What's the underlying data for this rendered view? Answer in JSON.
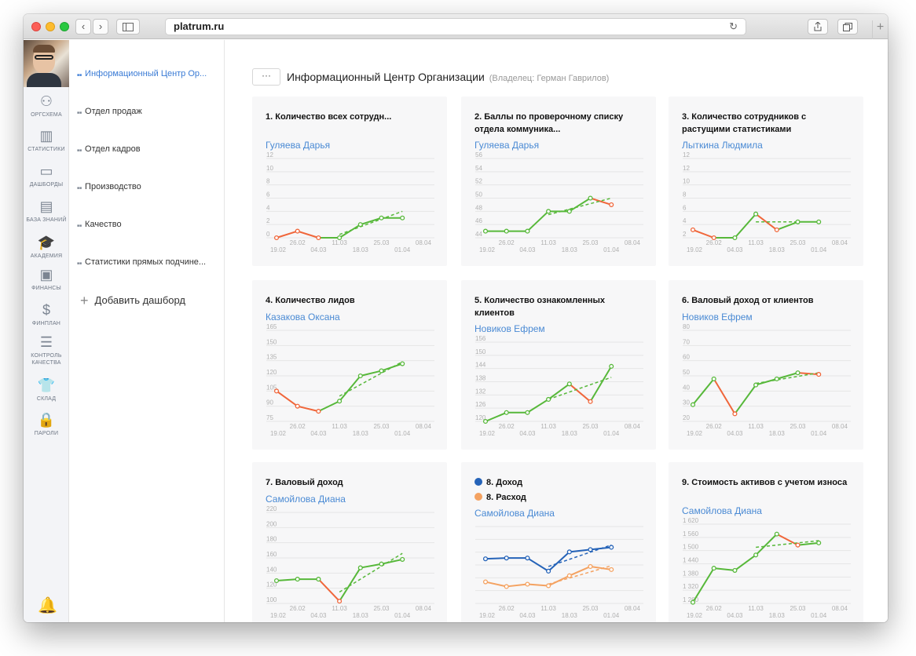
{
  "browser": {
    "url": "platrum.ru",
    "reload_icon": "↻",
    "new_tab_icon": "+"
  },
  "iconbar": {
    "items": [
      {
        "label": "ОРГСХЕМА",
        "icon": "org-chart-icon",
        "glyph": "⚇"
      },
      {
        "label": "СТАТИСТИКИ",
        "icon": "statistics-icon",
        "glyph": "▥"
      },
      {
        "label": "ДАШБОРДЫ",
        "icon": "dashboard-icon",
        "glyph": "▭"
      },
      {
        "label": "БАЗА ЗНАНИЙ",
        "icon": "knowledge-base-icon",
        "glyph": "▤"
      },
      {
        "label": "АКАДЕМИЯ",
        "icon": "academy-icon",
        "glyph": "🎓"
      },
      {
        "label": "ФИНАНСЫ",
        "icon": "finance-icon",
        "glyph": "▣"
      },
      {
        "label": "ФИНПЛАН",
        "icon": "finplan-icon",
        "glyph": "$"
      },
      {
        "label": "КОНТРОЛЬ КАЧЕСТВА",
        "icon": "quality-control-icon",
        "glyph": "☰"
      },
      {
        "label": "СКЛАД",
        "icon": "warehouse-icon",
        "glyph": "👕"
      },
      {
        "label": "ПАРОЛИ",
        "icon": "passwords-icon",
        "glyph": "🔒"
      }
    ],
    "bell_icon": "🔔"
  },
  "sidebar": {
    "items": [
      {
        "label": "Информационный Центр Ор...",
        "active": true
      },
      {
        "label": "Отдел продаж",
        "active": false
      },
      {
        "label": "Отдел кадров",
        "active": false
      },
      {
        "label": "Производство",
        "active": false
      },
      {
        "label": "Качество",
        "active": false
      },
      {
        "label": "Статистики прямых подчине...",
        "active": false
      }
    ],
    "add_label": "Добавить дашборд"
  },
  "header": {
    "more_label": "···",
    "title": "Информационный Центр Организации",
    "owner": "(Владелец: Герман Гаврилов)"
  },
  "colors": {
    "green": "#57b83a",
    "orange": "#f0663a",
    "blue": "#2563b8",
    "light_orange": "#f4a261",
    "grid": "#e6e6e6",
    "axis_text": "#b0b0b0",
    "link": "#4a8ad4"
  },
  "cards": [
    {
      "title": "1. Количество всех сотрудн...",
      "owner": "Гуляева Дарья"
    },
    {
      "title": "2. Баллы по проверочному списку отдела коммуника...",
      "owner": "Гуляева Дарья"
    },
    {
      "title": "3. Количество сотрудников с растущими статистиками",
      "owner": "Лыткина Людмила"
    },
    {
      "title": "4. Количество лидов",
      "owner": "Казакова Оксана"
    },
    {
      "title": "5. Количество ознакомленных клиентов",
      "owner": "Новиков Ефрем"
    },
    {
      "title": "6. Валовый доход от клиентов",
      "owner": "Новиков Ефрем"
    },
    {
      "title": "7. Валовый доход",
      "owner": "Самойлова Диана"
    },
    {
      "title": "8. Доход",
      "title2": "8. Расход",
      "owner": "Самойлова Диана"
    },
    {
      "title": "9. Стоимость активов с учетом износа",
      "owner": "Самойлова Диана"
    }
  ],
  "chart_data": [
    {
      "type": "line",
      "x": [
        "19.02",
        "26.02",
        "04.03",
        "11.03",
        "18.03",
        "25.03",
        "01.04",
        "08.04"
      ],
      "yticks": [
        "0",
        "2",
        "4",
        "6",
        "8",
        "10",
        "12"
      ],
      "ylim": [
        0,
        12
      ],
      "values": [
        0,
        1,
        0,
        0,
        2,
        3,
        3
      ],
      "segment_colors": [
        "orange",
        "orange",
        "green",
        "green",
        "green",
        "green"
      ],
      "trend": [
        [
          3,
          0.5
        ],
        [
          6,
          4
        ]
      ]
    },
    {
      "type": "line",
      "x": [
        "19.02",
        "26.02",
        "04.03",
        "11.03",
        "18.03",
        "25.03",
        "01.04",
        "08.04"
      ],
      "yticks": [
        "44",
        "46",
        "48",
        "50",
        "52",
        "54",
        "56"
      ],
      "ylim": [
        44,
        56
      ],
      "values": [
        45,
        45,
        45,
        48,
        48,
        50,
        49
      ],
      "segment_colors": [
        "green",
        "green",
        "green",
        "green",
        "green",
        "orange"
      ],
      "trend": [
        [
          3,
          47.5
        ],
        [
          6,
          50
        ]
      ]
    },
    {
      "type": "line",
      "x": [
        "19.02",
        "26.02",
        "04.03",
        "11.03",
        "18.03",
        "25.03",
        "01.04",
        "08.04"
      ],
      "yticks": [
        "2",
        "4",
        "6",
        "8",
        "10",
        "12",
        "12"
      ],
      "ylim": [
        2,
        12
      ],
      "values": [
        3,
        2,
        2,
        5,
        3,
        4,
        4
      ],
      "segment_colors": [
        "orange",
        "green",
        "green",
        "orange",
        "green",
        "green"
      ],
      "trend": [
        [
          3,
          4
        ],
        [
          6,
          4
        ]
      ]
    },
    {
      "type": "line",
      "x": [
        "19.02",
        "26.02",
        "04.03",
        "11.03",
        "18.03",
        "25.03",
        "01.04",
        "08.04"
      ],
      "yticks": [
        "75",
        "90",
        "105",
        "120",
        "135",
        "150",
        "165"
      ],
      "ylim": [
        75,
        165
      ],
      "values": [
        105,
        90,
        85,
        95,
        120,
        125,
        132
      ],
      "segment_colors": [
        "orange",
        "orange",
        "green",
        "green",
        "green",
        "green"
      ],
      "trend": [
        [
          3,
          100
        ],
        [
          6,
          134
        ]
      ]
    },
    {
      "type": "line",
      "x": [
        "19.02",
        "26.02",
        "04.03",
        "11.03",
        "18.03",
        "25.03",
        "01.04",
        "08.04"
      ],
      "yticks": [
        "120",
        "126",
        "132",
        "138",
        "144",
        "150",
        "156"
      ],
      "ylim": [
        120,
        156
      ],
      "values": [
        120,
        124,
        124,
        130,
        137,
        129,
        145
      ],
      "segment_colors": [
        "green",
        "green",
        "green",
        "green",
        "orange",
        "green"
      ],
      "trend": [
        [
          3,
          130
        ],
        [
          6,
          140
        ]
      ]
    },
    {
      "type": "line",
      "x": [
        "19.02",
        "26.02",
        "04.03",
        "11.03",
        "18.03",
        "25.03",
        "01.04",
        "08.04"
      ],
      "yticks": [
        "20",
        "30",
        "40",
        "50",
        "60",
        "70",
        "80"
      ],
      "ylim": [
        20,
        80
      ],
      "values": [
        31,
        48,
        25,
        44,
        48,
        52,
        51
      ],
      "segment_colors": [
        "green",
        "orange",
        "green",
        "green",
        "green",
        "orange"
      ],
      "trend": [
        [
          3,
          45
        ],
        [
          6,
          52
        ]
      ]
    },
    {
      "type": "line",
      "x": [
        "19.02",
        "26.02",
        "04.03",
        "11.03",
        "18.03",
        "25.03",
        "01.04",
        "08.04"
      ],
      "yticks": [
        "100",
        "120",
        "140",
        "160",
        "180",
        "200",
        "220"
      ],
      "ylim": [
        100,
        220
      ],
      "values": [
        130,
        132,
        132,
        103,
        147,
        152,
        158
      ],
      "segment_colors": [
        "green",
        "green",
        "orange",
        "green",
        "green",
        "green"
      ],
      "trend": [
        [
          3,
          115
        ],
        [
          6,
          166
        ]
      ]
    },
    {
      "type": "line",
      "x": [
        "19.02",
        "26.02",
        "04.03",
        "11.03",
        "18.03",
        "25.03",
        "01.04",
        "08.04"
      ],
      "ylim": [
        0,
        100
      ],
      "series": [
        {
          "name": "8. Доход",
          "color": "blue",
          "values": [
            58,
            59,
            59,
            42,
            67,
            70,
            73
          ],
          "trend": [
            [
              3,
              48
            ],
            [
              6,
              76
            ]
          ]
        },
        {
          "name": "8. Расход",
          "color": "light_orange",
          "values": [
            28,
            22,
            25,
            23,
            36,
            48,
            44
          ],
          "trend": [
            [
              3,
              25
            ],
            [
              6,
              49
            ]
          ]
        }
      ]
    },
    {
      "type": "line",
      "x": [
        "19.02",
        "26.02",
        "04.03",
        "11.03",
        "18.03",
        "25.03",
        "01.04",
        "08.04"
      ],
      "yticks": [
        "1 260",
        "1 320",
        "1 380",
        "1 440",
        "1 500",
        "1 560",
        "1 620"
      ],
      "ylim": [
        1260,
        1620
      ],
      "values": [
        1265,
        1420,
        1410,
        1480,
        1575,
        1525,
        1535
      ],
      "segment_colors": [
        "green",
        "green",
        "green",
        "green",
        "orange",
        "green"
      ],
      "trend": [
        [
          3,
          1515
        ],
        [
          6,
          1545
        ]
      ]
    }
  ]
}
